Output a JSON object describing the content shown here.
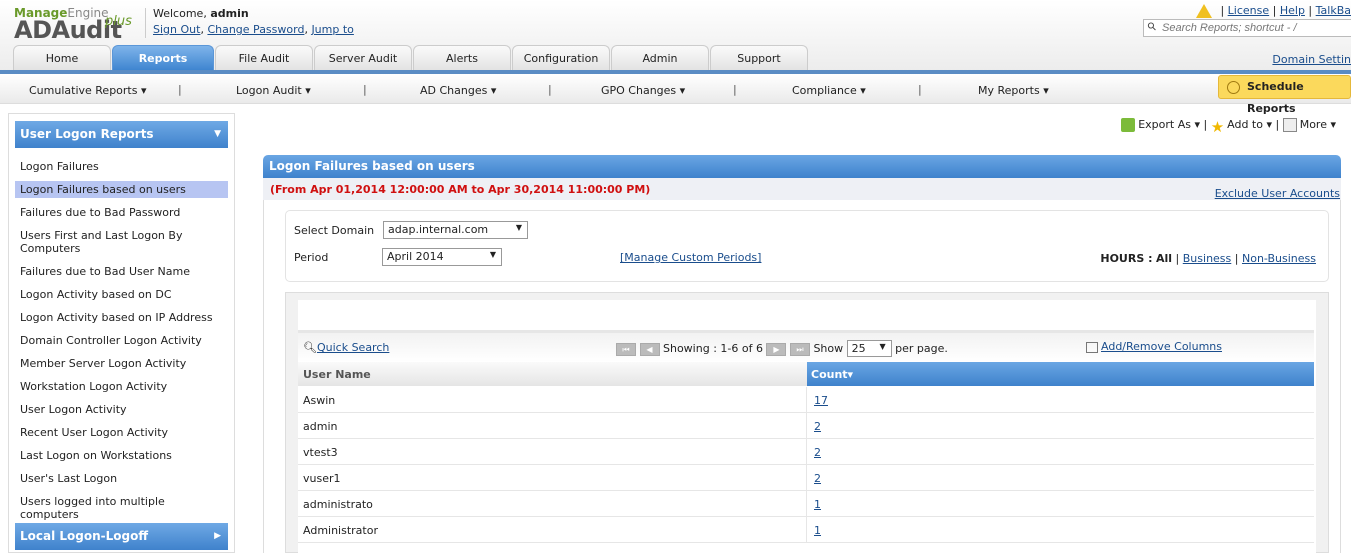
{
  "brand": {
    "company": "ManageEngine",
    "product": "ADAudit",
    "suffix": "plus"
  },
  "header": {
    "welcome": "Welcome,",
    "user": "admin",
    "links": [
      "Sign Out",
      "Change Password",
      "Jump to"
    ],
    "top_links": [
      "License",
      "Help",
      "TalkBa"
    ],
    "search_placeholder": "Search Reports; shortcut - /",
    "domain_settings": "Domain Settin"
  },
  "tabs": [
    {
      "label": "Home"
    },
    {
      "label": "Reports",
      "active": true
    },
    {
      "label": "File Audit"
    },
    {
      "label": "Server Audit"
    },
    {
      "label": "Alerts"
    },
    {
      "label": "Configuration"
    },
    {
      "label": "Admin"
    },
    {
      "label": "Support"
    }
  ],
  "subnav": [
    "Cumulative Reports ▾",
    "Logon Audit ▾",
    "AD Changes ▾",
    "GPO Changes ▾",
    "Compliance ▾",
    "My Reports ▾"
  ],
  "schedule_reports": "Schedule Reports",
  "sidebar": {
    "section1": "User Logon Reports",
    "items": [
      "Logon Failures",
      "Logon Failures based on users",
      "Failures due to Bad Password",
      "Users First and Last Logon By Computers",
      "Failures due to Bad User Name",
      "Logon Activity based on DC",
      "Logon Activity based on IP Address",
      "Domain Controller Logon Activity",
      "Member Server Logon Activity",
      "Workstation Logon Activity",
      "User Logon Activity",
      "Recent User Logon Activity",
      "Last Logon on Workstations",
      "User's Last Logon",
      "Users logged into multiple computers"
    ],
    "selected": 1,
    "section2": "Local Logon-Logoff"
  },
  "tools": {
    "export": "Export As ▾",
    "add_to": "Add to ▾",
    "more": "More ▾"
  },
  "report": {
    "title": "Logon Failures based on users",
    "range": "(From Apr 01,2014 12:00:00 AM to Apr 30,2014 11:00:00 PM)",
    "exclude": "Exclude User Accounts",
    "domain_label": "Select Domain",
    "domain_value": "adap.internal.com",
    "period_label": "Period",
    "period_value": "April 2014",
    "manage_periods": "[Manage Custom Periods]",
    "hours_label": "HOURS :",
    "hours_all": "All",
    "hours_business": "Business",
    "hours_nonbusiness": "Non-Business"
  },
  "grid": {
    "quick_search": "Quick Search",
    "showing": "Showing :  1-6 of 6",
    "show": "Show",
    "per_page_value": "25",
    "per_page": "per page.",
    "add_remove": "Add/Remove Columns",
    "columns": [
      "User Name",
      "Count▾"
    ],
    "rows": [
      [
        "Aswin",
        "17"
      ],
      [
        "admin",
        "2"
      ],
      [
        "vtest3",
        "2"
      ],
      [
        "vuser1",
        "2"
      ],
      [
        "administrato",
        "1"
      ],
      [
        "Administrator",
        "1"
      ]
    ]
  },
  "colors": {
    "accent": "#3f82cc",
    "highlight": "#b7c5f2",
    "range_text": "#d01010",
    "schedule": "#fbd95c"
  }
}
